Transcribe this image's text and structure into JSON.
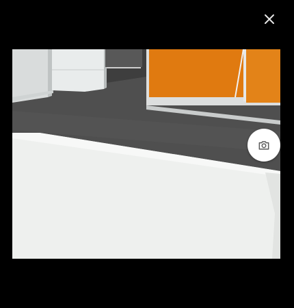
{
  "dialog": {
    "background": "#000000",
    "close_icon": "close-icon",
    "capture_icon": "camera-icon"
  },
  "preview": {
    "subject": "camera-feed",
    "colors": {
      "floor": "#4f4f4f",
      "desk": "#eef0ee",
      "cabinet": "#e07a10",
      "wall": "#d8dcdc"
    }
  }
}
